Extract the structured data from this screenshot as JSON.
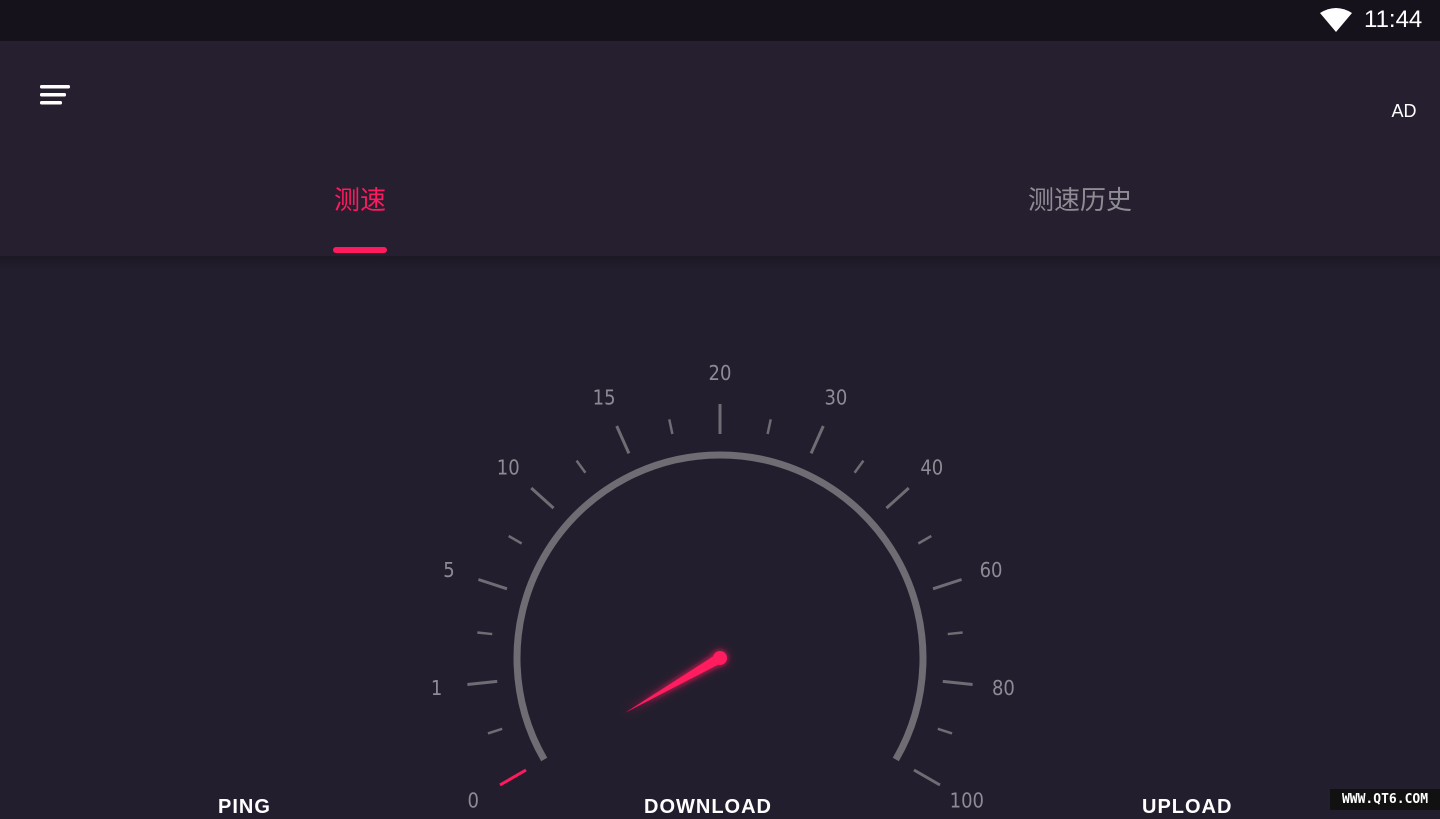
{
  "status_bar": {
    "time": "11:44",
    "wifi_icon": "wifi-icon"
  },
  "app_bar": {
    "menu_icon": "menu-icon",
    "ad_label": "AD"
  },
  "tabs": [
    {
      "label": "测速",
      "active": true
    },
    {
      "label": "测速历史",
      "active": false
    }
  ],
  "colors": {
    "accent": "#ff1a5e",
    "background": "#231e2d",
    "app_bar": "#251f2f",
    "status_bar": "#16121c",
    "gauge_arc": "#6f6c73",
    "tick_label": "#8f8b94",
    "inactive_tab": "#8f8b94"
  },
  "gauge": {
    "scale_labels": [
      "0",
      "1",
      "5",
      "10",
      "15",
      "20",
      "30",
      "40",
      "60",
      "80",
      "100"
    ],
    "current_value": 0,
    "needle_color": "#ff1a5e"
  },
  "bottom_labels": [
    "PING",
    "DOWNLOAD",
    "UPLOAD"
  ],
  "watermark": "WWW.QT6.COM"
}
